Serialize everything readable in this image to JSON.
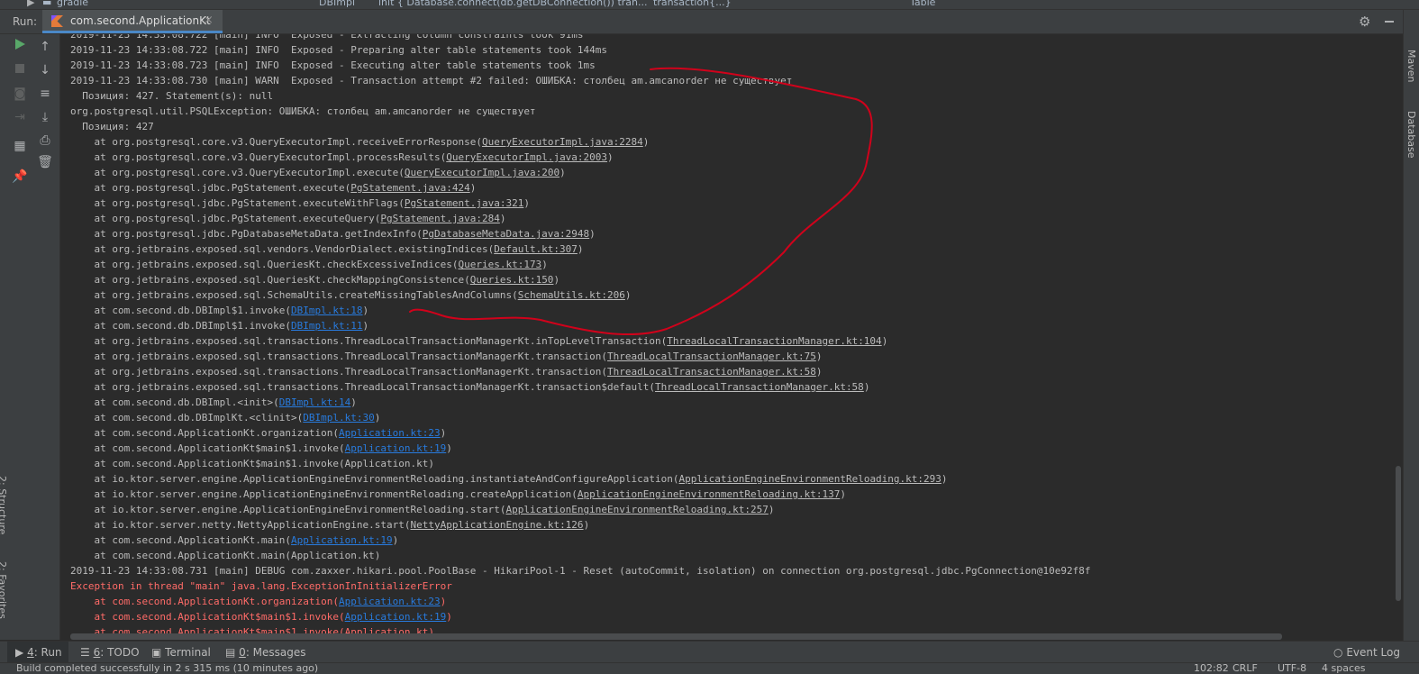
{
  "top_strip": {
    "project_item": "gradle",
    "breadcrumb": [
      "DBImpl",
      "init { Database.connect(db.getDBConnection()) tran...",
      "transaction{...}"
    ],
    "right_label": "Table"
  },
  "run_panel": {
    "label": "Run:",
    "tab_title": "com.second.ApplicationKt",
    "close_glyph": "×"
  },
  "icons": {
    "run": "run-icon",
    "stop": "stop-icon",
    "settings": "gear-icon",
    "scroll_up": "arrow-up-icon",
    "scroll_down": "arrow-down-icon"
  },
  "log_lines": [
    {
      "pre": "2019-11-23 14:33:08.722 [main] INFO  Exposed - Extracting column constraints took 91ms",
      "link": "",
      "post": "",
      "err": false
    },
    {
      "pre": "2019-11-23 14:33:08.722 [main] INFO  Exposed - Preparing alter table statements took 144ms",
      "link": "",
      "post": "",
      "err": false
    },
    {
      "pre": "2019-11-23 14:33:08.723 [main] INFO  Exposed - Executing alter table statements took 1ms",
      "link": "",
      "post": "",
      "err": false
    },
    {
      "pre": "2019-11-23 14:33:08.730 [main] WARN  Exposed - Transaction attempt #2 failed: ОШИБКА: столбец am.amcanorder не существует",
      "link": "",
      "post": "",
      "err": false
    },
    {
      "pre": "  Позиция: 427. Statement(s): null",
      "link": "",
      "post": "",
      "err": false
    },
    {
      "pre": "org.postgresql.util.PSQLException: ОШИБКА: столбец am.amcanorder не существует",
      "link": "",
      "post": "",
      "err": false
    },
    {
      "pre": "  Позиция: 427",
      "link": "",
      "post": "",
      "err": false
    },
    {
      "pre": "    at org.postgresql.core.v3.QueryExecutorImpl.receiveErrorResponse(",
      "link": "QueryExecutorImpl.java:2284",
      "post": ")",
      "err": false,
      "lib": true
    },
    {
      "pre": "    at org.postgresql.core.v3.QueryExecutorImpl.processResults(",
      "link": "QueryExecutorImpl.java:2003",
      "post": ")",
      "err": false,
      "lib": true
    },
    {
      "pre": "    at org.postgresql.core.v3.QueryExecutorImpl.execute(",
      "link": "QueryExecutorImpl.java:200",
      "post": ")",
      "err": false,
      "lib": true
    },
    {
      "pre": "    at org.postgresql.jdbc.PgStatement.execute(",
      "link": "PgStatement.java:424",
      "post": ")",
      "err": false,
      "lib": true
    },
    {
      "pre": "    at org.postgresql.jdbc.PgStatement.executeWithFlags(",
      "link": "PgStatement.java:321",
      "post": ")",
      "err": false,
      "lib": true
    },
    {
      "pre": "    at org.postgresql.jdbc.PgStatement.executeQuery(",
      "link": "PgStatement.java:284",
      "post": ")",
      "err": false,
      "lib": true
    },
    {
      "pre": "    at org.postgresql.jdbc.PgDatabaseMetaData.getIndexInfo(",
      "link": "PgDatabaseMetaData.java:2948",
      "post": ")",
      "err": false,
      "lib": true
    },
    {
      "pre": "    at org.jetbrains.exposed.sql.vendors.VendorDialect.existingIndices(",
      "link": "Default.kt:307",
      "post": ")",
      "err": false,
      "lib": true
    },
    {
      "pre": "    at org.jetbrains.exposed.sql.QueriesKt.checkExcessiveIndices(",
      "link": "Queries.kt:173",
      "post": ")",
      "err": false,
      "lib": true
    },
    {
      "pre": "    at org.jetbrains.exposed.sql.QueriesKt.checkMappingConsistence(",
      "link": "Queries.kt:150",
      "post": ")",
      "err": false,
      "lib": true
    },
    {
      "pre": "    at org.jetbrains.exposed.sql.SchemaUtils.createMissingTablesAndColumns(",
      "link": "SchemaUtils.kt:206",
      "post": ")",
      "err": false,
      "lib": true
    },
    {
      "pre": "    at com.second.db.DBImpl$1.invoke(",
      "link": "DBImpl.kt:18",
      "post": ")",
      "err": false
    },
    {
      "pre": "    at com.second.db.DBImpl$1.invoke(",
      "link": "DBImpl.kt:11",
      "post": ")",
      "err": false
    },
    {
      "pre": "    at org.jetbrains.exposed.sql.transactions.ThreadLocalTransactionManagerKt.inTopLevelTransaction(",
      "link": "ThreadLocalTransactionManager.kt:104",
      "post": ")",
      "err": false,
      "lib": true
    },
    {
      "pre": "    at org.jetbrains.exposed.sql.transactions.ThreadLocalTransactionManagerKt.transaction(",
      "link": "ThreadLocalTransactionManager.kt:75",
      "post": ")",
      "err": false,
      "lib": true
    },
    {
      "pre": "    at org.jetbrains.exposed.sql.transactions.ThreadLocalTransactionManagerKt.transaction(",
      "link": "ThreadLocalTransactionManager.kt:58",
      "post": ")",
      "err": false,
      "lib": true
    },
    {
      "pre": "    at org.jetbrains.exposed.sql.transactions.ThreadLocalTransactionManagerKt.transaction$default(",
      "link": "ThreadLocalTransactionManager.kt:58",
      "post": ")",
      "err": false,
      "lib": true
    },
    {
      "pre": "    at com.second.db.DBImpl.<init>(",
      "link": "DBImpl.kt:14",
      "post": ")",
      "err": false
    },
    {
      "pre": "    at com.second.db.DBImplKt.<clinit>(",
      "link": "DBImpl.kt:30",
      "post": ")",
      "err": false
    },
    {
      "pre": "    at com.second.ApplicationKt.organization(",
      "link": "Application.kt:23",
      "post": ")",
      "err": false
    },
    {
      "pre": "    at com.second.ApplicationKt$main$1.invoke(",
      "link": "Application.kt:19",
      "post": ")",
      "err": false
    },
    {
      "pre": "    at com.second.ApplicationKt$main$1.invoke(Application.kt)",
      "link": "",
      "post": "",
      "err": false
    },
    {
      "pre": "    at io.ktor.server.engine.ApplicationEngineEnvironmentReloading.instantiateAndConfigureApplication(",
      "link": "ApplicationEngineEnvironmentReloading.kt:293",
      "post": ")",
      "err": false,
      "lib": true
    },
    {
      "pre": "    at io.ktor.server.engine.ApplicationEngineEnvironmentReloading.createApplication(",
      "link": "ApplicationEngineEnvironmentReloading.kt:137",
      "post": ")",
      "err": false,
      "lib": true
    },
    {
      "pre": "    at io.ktor.server.engine.ApplicationEngineEnvironmentReloading.start(",
      "link": "ApplicationEngineEnvironmentReloading.kt:257",
      "post": ")",
      "err": false,
      "lib": true
    },
    {
      "pre": "    at io.ktor.server.netty.NettyApplicationEngine.start(",
      "link": "NettyApplicationEngine.kt:126",
      "post": ")",
      "err": false,
      "lib": true
    },
    {
      "pre": "    at com.second.ApplicationKt.main(",
      "link": "Application.kt:19",
      "post": ")",
      "err": false
    },
    {
      "pre": "    at com.second.ApplicationKt.main(Application.kt)",
      "link": "",
      "post": "",
      "err": false
    },
    {
      "pre": "2019-11-23 14:33:08.731 [main] DEBUG com.zaxxer.hikari.pool.PoolBase - HikariPool-1 - Reset (autoCommit, isolation) on connection org.postgresql.jdbc.PgConnection@10e92f8f",
      "link": "",
      "post": "",
      "err": false
    },
    {
      "pre": "Exception in thread \"main\" java.lang.ExceptionInInitializerError",
      "link": "",
      "post": "",
      "err": true
    },
    {
      "pre": "    at com.second.ApplicationKt.organization(",
      "link": "Application.kt:23",
      "post": ")",
      "err": true
    },
    {
      "pre": "    at com.second.ApplicationKt$main$1.invoke(",
      "link": "Application.kt:19",
      "post": ")",
      "err": true
    },
    {
      "pre": "    at com.second.ApplicationKt$main$1.invoke(Application.kt)",
      "link": "",
      "post": "",
      "err": true
    }
  ],
  "bottom_tabs": [
    {
      "num": "4",
      "label": ": Run",
      "icon": "play-icon",
      "active": true
    },
    {
      "num": "6",
      "label": ": TODO",
      "icon": "list-icon",
      "active": false
    },
    {
      "num": "",
      "label": "Terminal",
      "icon": "terminal-icon",
      "active": false
    },
    {
      "num": "0",
      "label": ": Messages",
      "icon": "messages-icon",
      "active": false
    }
  ],
  "event_log": "Event Log",
  "right_tools": [
    "Maven",
    "Database"
  ],
  "left_tools": [
    "2: Structure",
    "2: Favorites"
  ],
  "status": {
    "message": "Build completed successfully in 2 s 315 ms (10 minutes ago)",
    "position": "102:82",
    "line_sep": "CRLF",
    "encoding": "UTF-8",
    "indent": "4 spaces"
  },
  "colors": {
    "link": "#287bde",
    "error": "#ff6b68",
    "annotation": "#d0021b"
  }
}
